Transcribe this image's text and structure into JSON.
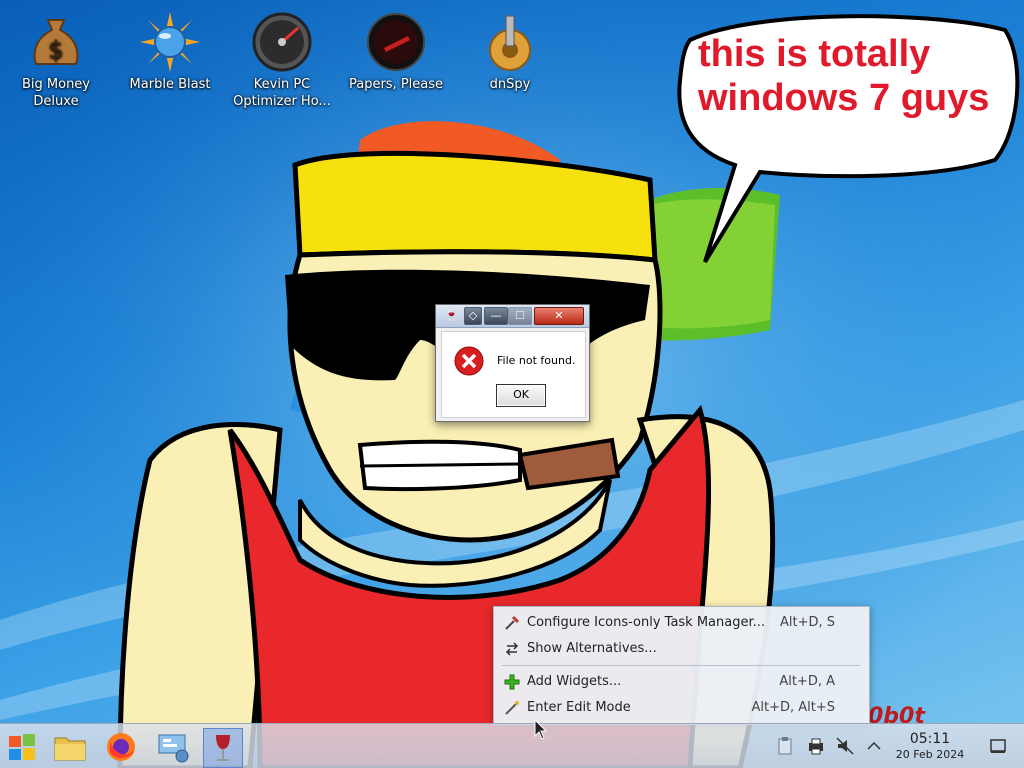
{
  "desktop_icons": [
    {
      "label": "Big Money\nDeluxe",
      "icon": "money-bag-icon"
    },
    {
      "label": "Marble Blast",
      "icon": "marble-sun-icon"
    },
    {
      "label": "Kevin PC\nOptimizer Ho...",
      "icon": "gauge-icon"
    },
    {
      "label": "Papers, Please",
      "icon": "papers-please-icon"
    },
    {
      "label": "dnSpy",
      "icon": "gear-icon"
    }
  ],
  "speech_bubble": {
    "line1": "this is totally",
    "line2": "windows 7 guys"
  },
  "corner_text": "0b0t",
  "dialog": {
    "message": "File not found.",
    "ok_label": "OK",
    "close_glyph": "✕",
    "min_glyph": "—",
    "max_glyph": "☐",
    "pin_glyph": "◇"
  },
  "context_menu": {
    "items": [
      {
        "label": "Configure Icons-only Task Manager...",
        "shortcut": "Alt+D, S",
        "icon": "configure-icon"
      },
      {
        "label": "Show Alternatives...",
        "shortcut": "",
        "icon": "alternatives-icon"
      },
      {
        "label": "Add Widgets...",
        "shortcut": "Alt+D, A",
        "icon": "plus-icon"
      },
      {
        "label": "Enter Edit Mode",
        "shortcut": "Alt+D, Alt+S",
        "icon": "edit-icon"
      }
    ]
  },
  "taskbar": {
    "apps": [
      "start-orb-icon",
      "file-manager-icon",
      "firefox-icon",
      "system-settings-icon",
      "wine-glass-icon"
    ],
    "clock_time": "05:11",
    "clock_date": "20 Feb 2024"
  },
  "colors": {
    "accent": "#1a7fd4",
    "bubble_text": "#e0192b",
    "error_red": "#d81e1e"
  }
}
